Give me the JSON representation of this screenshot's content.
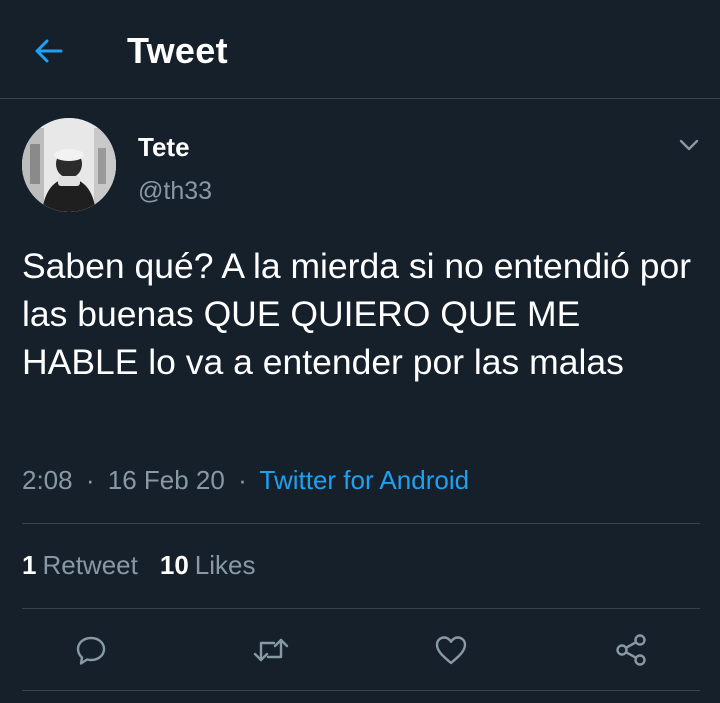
{
  "header": {
    "title": "Tweet",
    "back_icon": "arrow-left-icon"
  },
  "colors": {
    "background": "#15202b",
    "accent": "#1da1f2",
    "muted": "#8899a6",
    "divider": "#38444d"
  },
  "tweet": {
    "author_name": "Tete",
    "author_handle": "@th33",
    "text": "Saben qué? A la mierda si no entendió por las buenas QUE QUIERO QUE ME HABLE lo va a entender por las malas",
    "time": "2:08",
    "date": "16 Feb 20",
    "separator": "·",
    "source": "Twitter for Android"
  },
  "stats": {
    "retweets_count": "1",
    "retweets_label": "Retweet",
    "likes_count": "10",
    "likes_label": "Likes"
  },
  "actions": [
    "reply-icon",
    "retweet-icon",
    "like-icon",
    "share-icon"
  ]
}
